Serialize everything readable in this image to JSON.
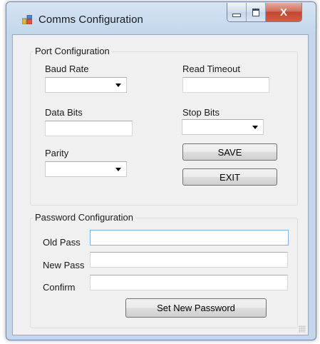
{
  "window": {
    "title": "Comms Configuration",
    "close_glyph": "X"
  },
  "port": {
    "group_title": "Port Configuration",
    "baud_label": "Baud Rate",
    "baud_value": "",
    "read_timeout_label": "Read Timeout",
    "read_timeout_value": "",
    "data_bits_label": "Data Bits",
    "data_bits_value": "",
    "stop_bits_label": "Stop Bits",
    "stop_bits_value": "",
    "parity_label": "Parity",
    "parity_value": "",
    "save_label": "SAVE",
    "exit_label": "EXIT"
  },
  "password": {
    "group_title": "Password Configuration",
    "old_label": "Old Pass",
    "old_value": "",
    "new_label": "New Pass",
    "new_value": "",
    "confirm_label": "Confirm",
    "confirm_value": "",
    "set_label": "Set New Password"
  },
  "colors": {
    "title_bar": "#c3d6ea",
    "close_button": "#c3452e",
    "focus_border": "#7eb4ea"
  }
}
